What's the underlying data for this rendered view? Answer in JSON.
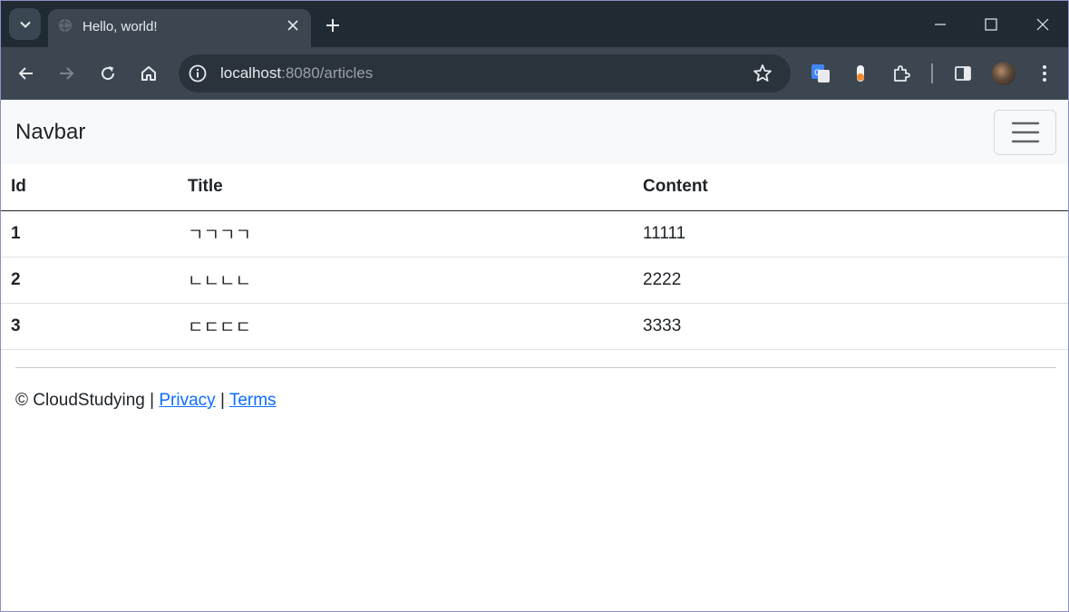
{
  "browser": {
    "tab": {
      "title": "Hello, world!"
    },
    "address": {
      "host": "localhost",
      "rest": ":8080/articles"
    },
    "icons": {
      "tab_search": "chevron-down-icon",
      "favicon": "globe-icon",
      "tab_close": "close-icon",
      "new_tab": "plus-icon",
      "back": "back-arrow-icon",
      "forward": "forward-arrow-icon",
      "reload": "reload-icon",
      "home": "home-icon",
      "site_info": "info-icon",
      "bookmark": "star-icon",
      "translate_ext": "google-translate-icon",
      "extension2": "extension-icon",
      "extensions": "puzzle-icon",
      "side_panel": "side-panel-icon",
      "profile": "avatar",
      "menu": "kebab-menu-icon"
    },
    "colors": {
      "frame": "#202a33",
      "toolbar": "#3b4650",
      "omnibox": "#2a333c"
    }
  },
  "navbar": {
    "brand": "Navbar",
    "toggler_icon": "hamburger-icon"
  },
  "table": {
    "headers": [
      "Id",
      "Title",
      "Content"
    ],
    "rows": [
      [
        "1",
        "ㄱㄱㄱㄱ",
        "11111"
      ],
      [
        "2",
        "ㄴㄴㄴㄴ",
        "2222"
      ],
      [
        "3",
        "ㄷㄷㄷㄷ",
        "3333"
      ]
    ]
  },
  "footer": {
    "copyright": "© CloudStudying",
    "separator": "|",
    "privacy": "Privacy",
    "terms": "Terms",
    "link_color": "#0d6efd"
  }
}
